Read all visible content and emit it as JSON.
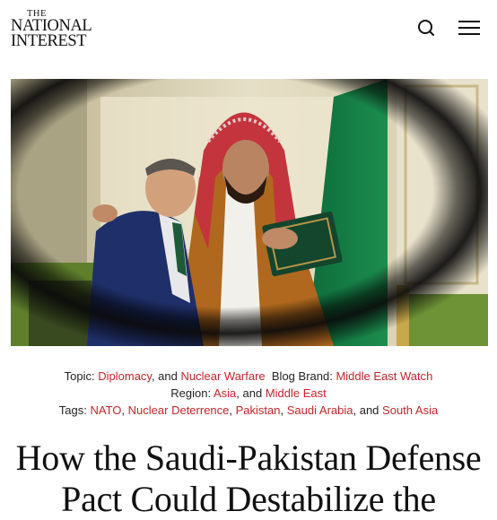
{
  "header": {
    "logo": {
      "the": "THE",
      "line1": "NATIONAL",
      "line2": "INTEREST"
    },
    "search_icon": "search-icon",
    "menu_icon": "hamburger-menu-icon"
  },
  "hero": {
    "image": "photo-of-two-men-embracing-framed-by-dark-lens-vignette"
  },
  "meta": {
    "topic_label": "Topic:",
    "topics": [
      "Diplomacy",
      "Nuclear Warfare"
    ],
    "and1": ", and",
    "blog_brand_label": "Blog Brand:",
    "blog_brand": "Middle East Watch",
    "region_label": "Region:",
    "regions": [
      "Asia",
      "Middle East"
    ],
    "and2": ", and",
    "tags_label": "Tags:",
    "tags": [
      "NATO",
      "Nuclear Deterrence",
      "Pakistan",
      "Saudi Arabia",
      "South Asia"
    ],
    "comma": ",",
    "and3": ", and",
    "link_color": "#c7242b"
  },
  "article": {
    "title_line1": "How the Saudi-Pakistan Defense",
    "title_line2": "Pact Could Destabilize the"
  }
}
